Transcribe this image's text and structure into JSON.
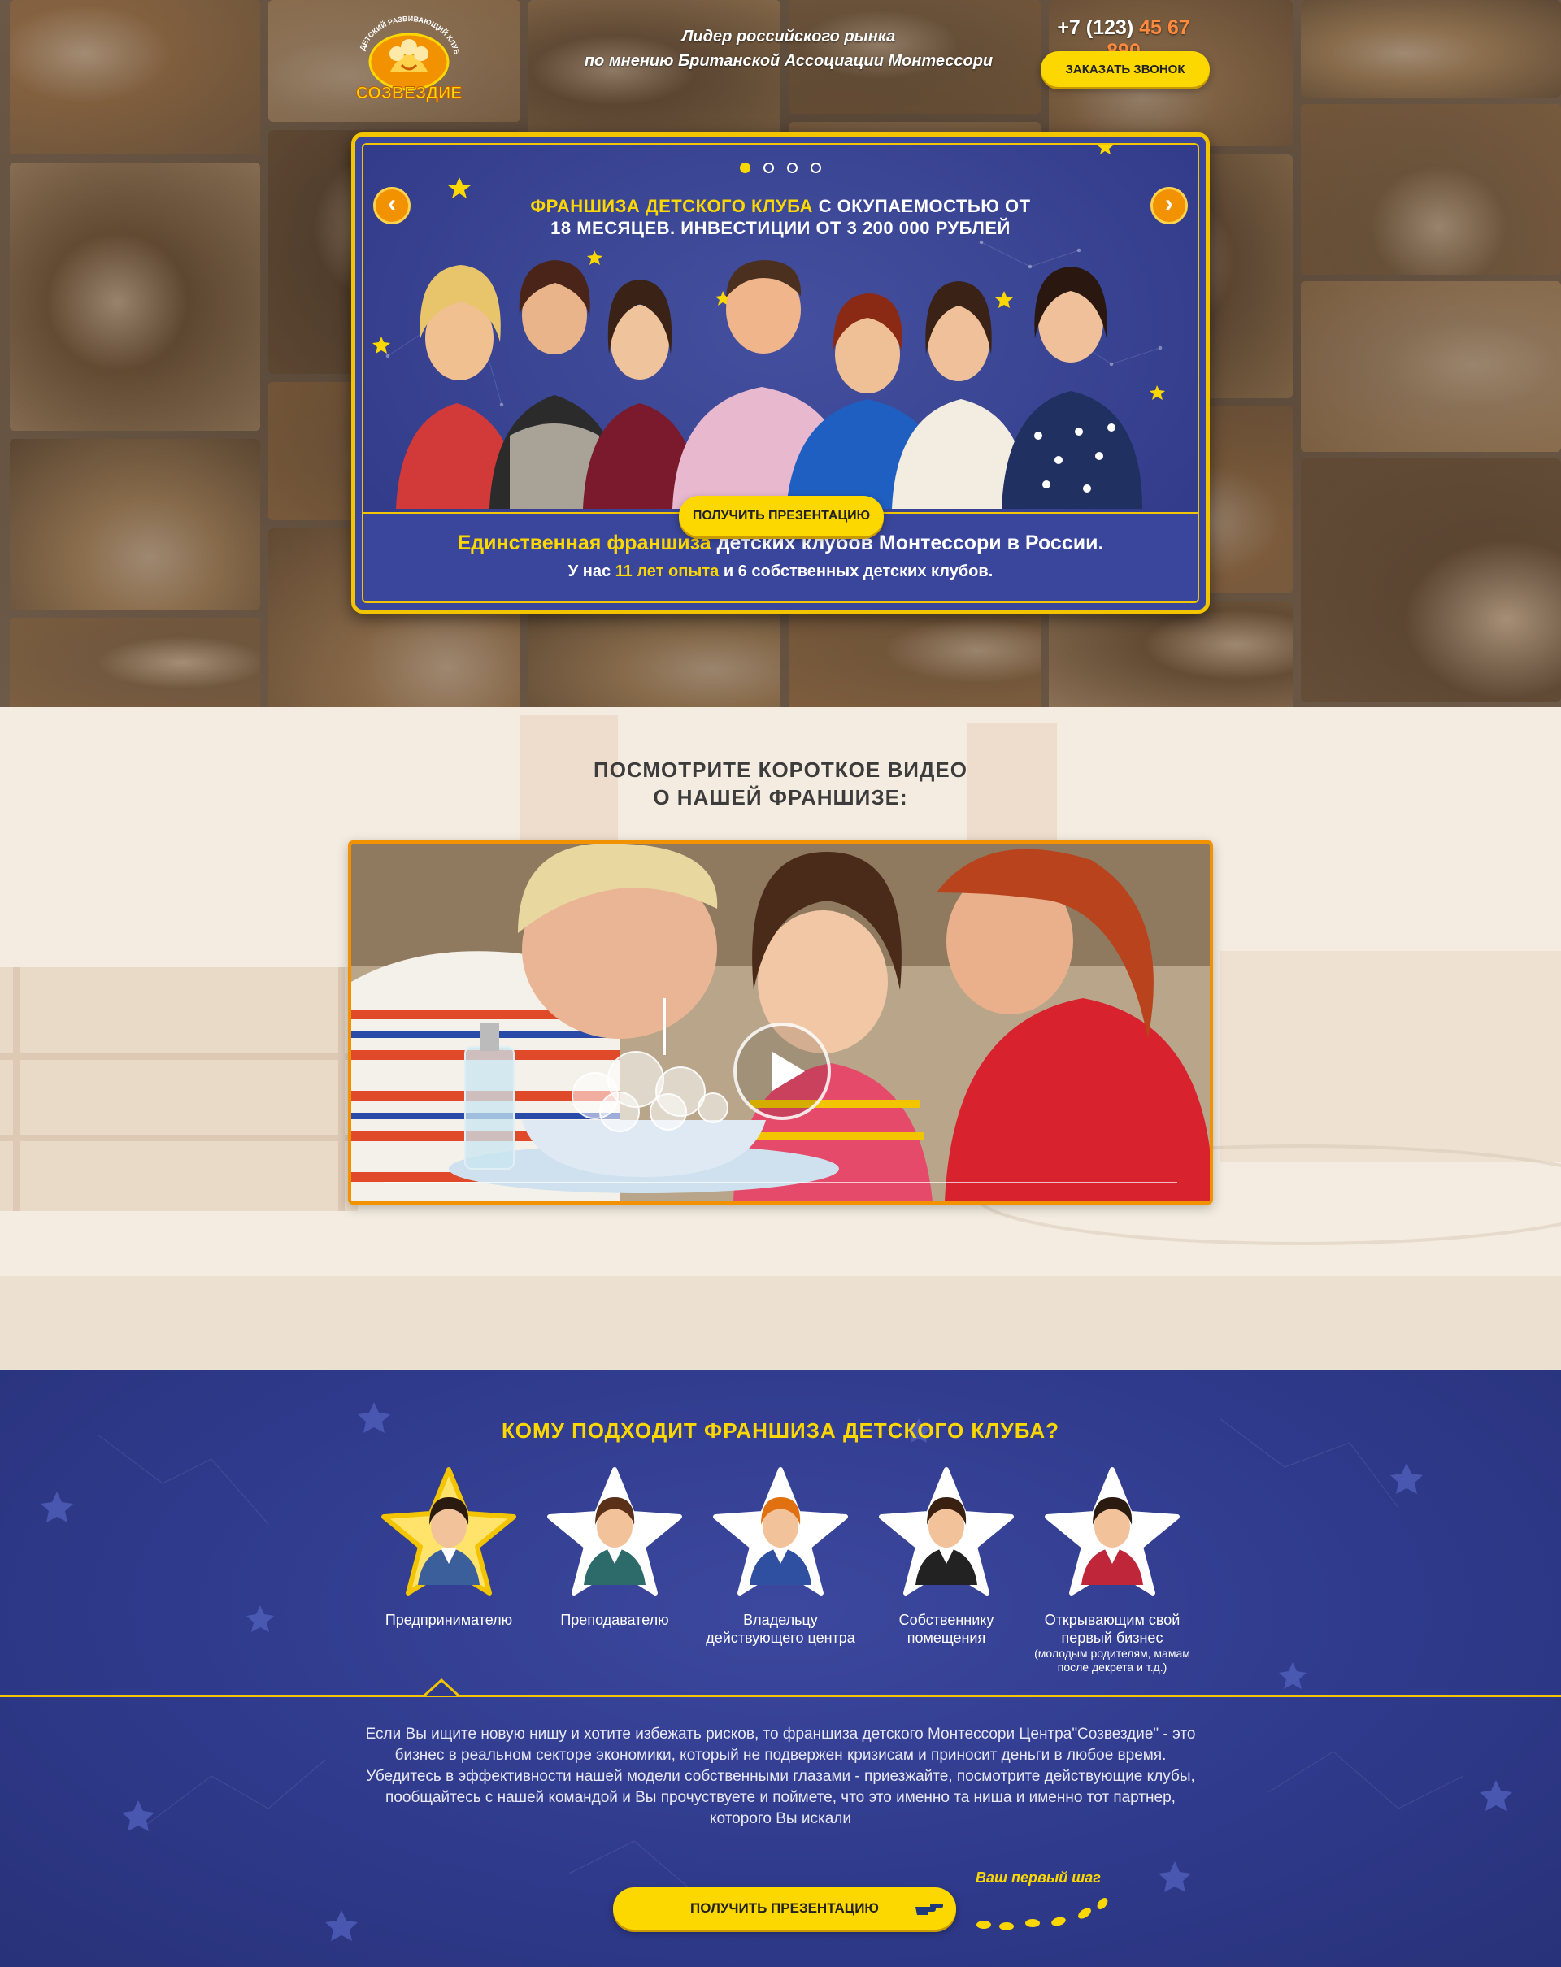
{
  "header": {
    "logo_top_text": "ДЕТСКИЙ РАЗВИВАЮЩИЙ КЛУБ",
    "logo_name": "СОЗВЕЗДИЕ",
    "tagline_line1": "Лидер российского рынка",
    "tagline_line2": "по мнению Британской Ассоциации Монтессори",
    "phone_prefix": "+7 (123)",
    "phone_number": "45 67 890",
    "callback_label": "ЗАКАЗАТЬ ЗВОНОК"
  },
  "slider": {
    "title_highlight": "ФРАНШИЗА ДЕТСКОГО КЛУБА",
    "title_rest1": "С ОКУПАЕМОСТЬЮ ОТ",
    "title_line2": "18 МЕСЯЦЕВ. ИНВЕСТИЦИИ ОТ 3 200 000 РУБЛЕЙ",
    "dots": 4,
    "active_dot": 1,
    "prev_icon": "chevron-left-icon",
    "next_icon": "chevron-right-icon",
    "present_label": "ПОЛУЧИТЬ ПРЕЗЕНТАЦИЮ",
    "unique_highlight": "Единственная франшиза",
    "unique_rest": "детских клубов Монтессори в России.",
    "exp_prefix": "У нас",
    "exp_highlight": "11 лет опыта",
    "exp_rest": "и 6 собственных детских клубов."
  },
  "video": {
    "title_line1": "ПОСМОТРИТЕ КОРОТКОЕ ВИДЕО",
    "title_line2": "О НАШЕЙ ФРАНШИЗЕ:",
    "play_icon": "play-icon"
  },
  "who": {
    "title": "КОМУ ПОДХОДИТ ФРАНШИЗА ДЕТСКОГО КЛУБА?",
    "personas": [
      {
        "label": "Предпринимателю",
        "sub": ""
      },
      {
        "label": "Преподавателю",
        "sub": ""
      },
      {
        "label": "Владельцу действующего центра",
        "sub": ""
      },
      {
        "label": "Собственнику помещения",
        "sub": ""
      },
      {
        "label": "Открывающим свой первый бизнес",
        "sub": "(молодым родителям, мамам после декрета и т.д.)"
      }
    ],
    "active_persona": 0,
    "description": "Если Вы ищите новую нишу и хотите избежать рисков, то франшиза детского Монтессори Центра\"Созвездие\"  - это бизнес в реальном секторе  экономики, который не подвержен кризисам и приносит деньги в любое время. Убедитесь в эффективности нашей модели собственными глазами - приезжайте, посмотрите действующие клубы, пообщайтесь с нашей командой и Вы прочуствуете и поймете, что это именно та ниша и именно тот партнер, которого Вы искали",
    "present_label": "ПОЛУЧИТЬ ПРЕЗЕНТАЦИЮ",
    "first_step": "Ваш первый шаг"
  },
  "colors": {
    "brand_yellow": "#fdd800",
    "brand_orange": "#f39200",
    "brand_navy": "#2f3a8c"
  }
}
